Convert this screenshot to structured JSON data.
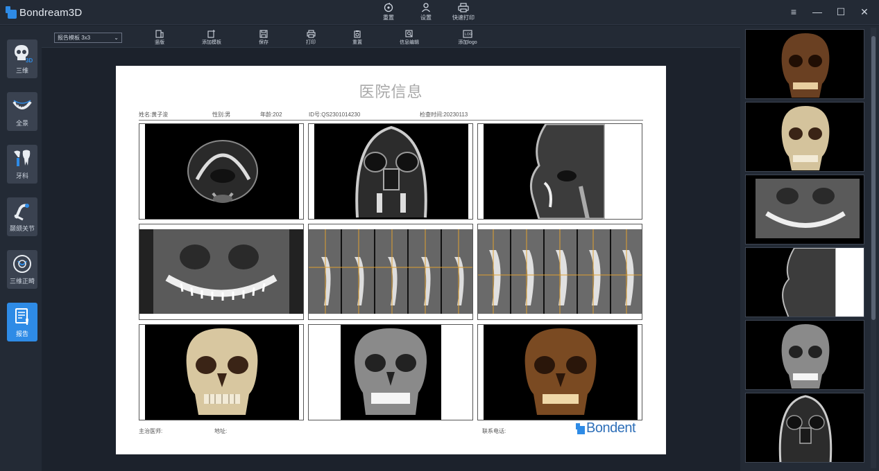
{
  "app": {
    "title": "Bondream3D"
  },
  "top_actions": [
    {
      "label": "重置",
      "icon": "reset-icon"
    },
    {
      "label": "设置",
      "icon": "user-settings-icon"
    },
    {
      "label": "快速打印",
      "icon": "printer-icon"
    }
  ],
  "window": {
    "menu": "≡",
    "minimize": "—",
    "maximize": "☐",
    "close": "✕"
  },
  "sidebar": {
    "items": [
      {
        "label": "三维",
        "icon": "skull-3d-icon"
      },
      {
        "label": "全景",
        "icon": "panoramic-jaw-icon"
      },
      {
        "label": "牙科",
        "icon": "tooth-implant-icon"
      },
      {
        "label": "颞颌关节",
        "icon": "tmj-joint-icon"
      },
      {
        "label": "三维正畸",
        "icon": "orthodontic-icon"
      },
      {
        "label": "报告",
        "icon": "report-icon"
      }
    ],
    "active": "报告"
  },
  "toolbar": {
    "template_select": "报告模板 3x3",
    "buttons": [
      {
        "label": "竖版",
        "icon": "portrait-icon"
      },
      {
        "label": "添加模板",
        "icon": "add-template-icon"
      },
      {
        "label": "保存",
        "icon": "save-icon"
      },
      {
        "label": "打印",
        "icon": "printer-icon"
      },
      {
        "label": "重置",
        "icon": "clipboard-reset-icon"
      },
      {
        "label": "信息编辑",
        "icon": "edit-info-icon"
      },
      {
        "label": "添加logo",
        "icon": "add-logo-icon"
      }
    ]
  },
  "report": {
    "title": "医院信息",
    "patient": {
      "name": "姓名:黄子浚",
      "gender": "性别:男",
      "age": "年龄:202",
      "id": "ID号:QS2301014230",
      "exam_time": "检查时间:20230113"
    },
    "footer": {
      "doctor": "主治医师:",
      "address": "地址:",
      "phone": "联系电话:"
    },
    "logo_text": "Bondent",
    "cells": [
      {
        "view": "axial-slice"
      },
      {
        "view": "coronal-slice"
      },
      {
        "view": "sagittal-slice"
      },
      {
        "view": "panoramic"
      },
      {
        "view": "cross-section-strip"
      },
      {
        "view": "cross-section-strip"
      },
      {
        "view": "3d-skull-bone"
      },
      {
        "view": "3d-skull-xray"
      },
      {
        "view": "3d-skull-soft"
      }
    ]
  },
  "thumbnails": [
    {
      "view": "3d-skull-soft"
    },
    {
      "view": "3d-skull-bone"
    },
    {
      "view": "panoramic"
    },
    {
      "view": "sagittal-slice"
    },
    {
      "view": "3d-skull-xray"
    },
    {
      "view": "coronal-slice"
    }
  ],
  "colors": {
    "accent": "#2e8be6",
    "bg": "#1c222c",
    "panel": "#232a35"
  }
}
